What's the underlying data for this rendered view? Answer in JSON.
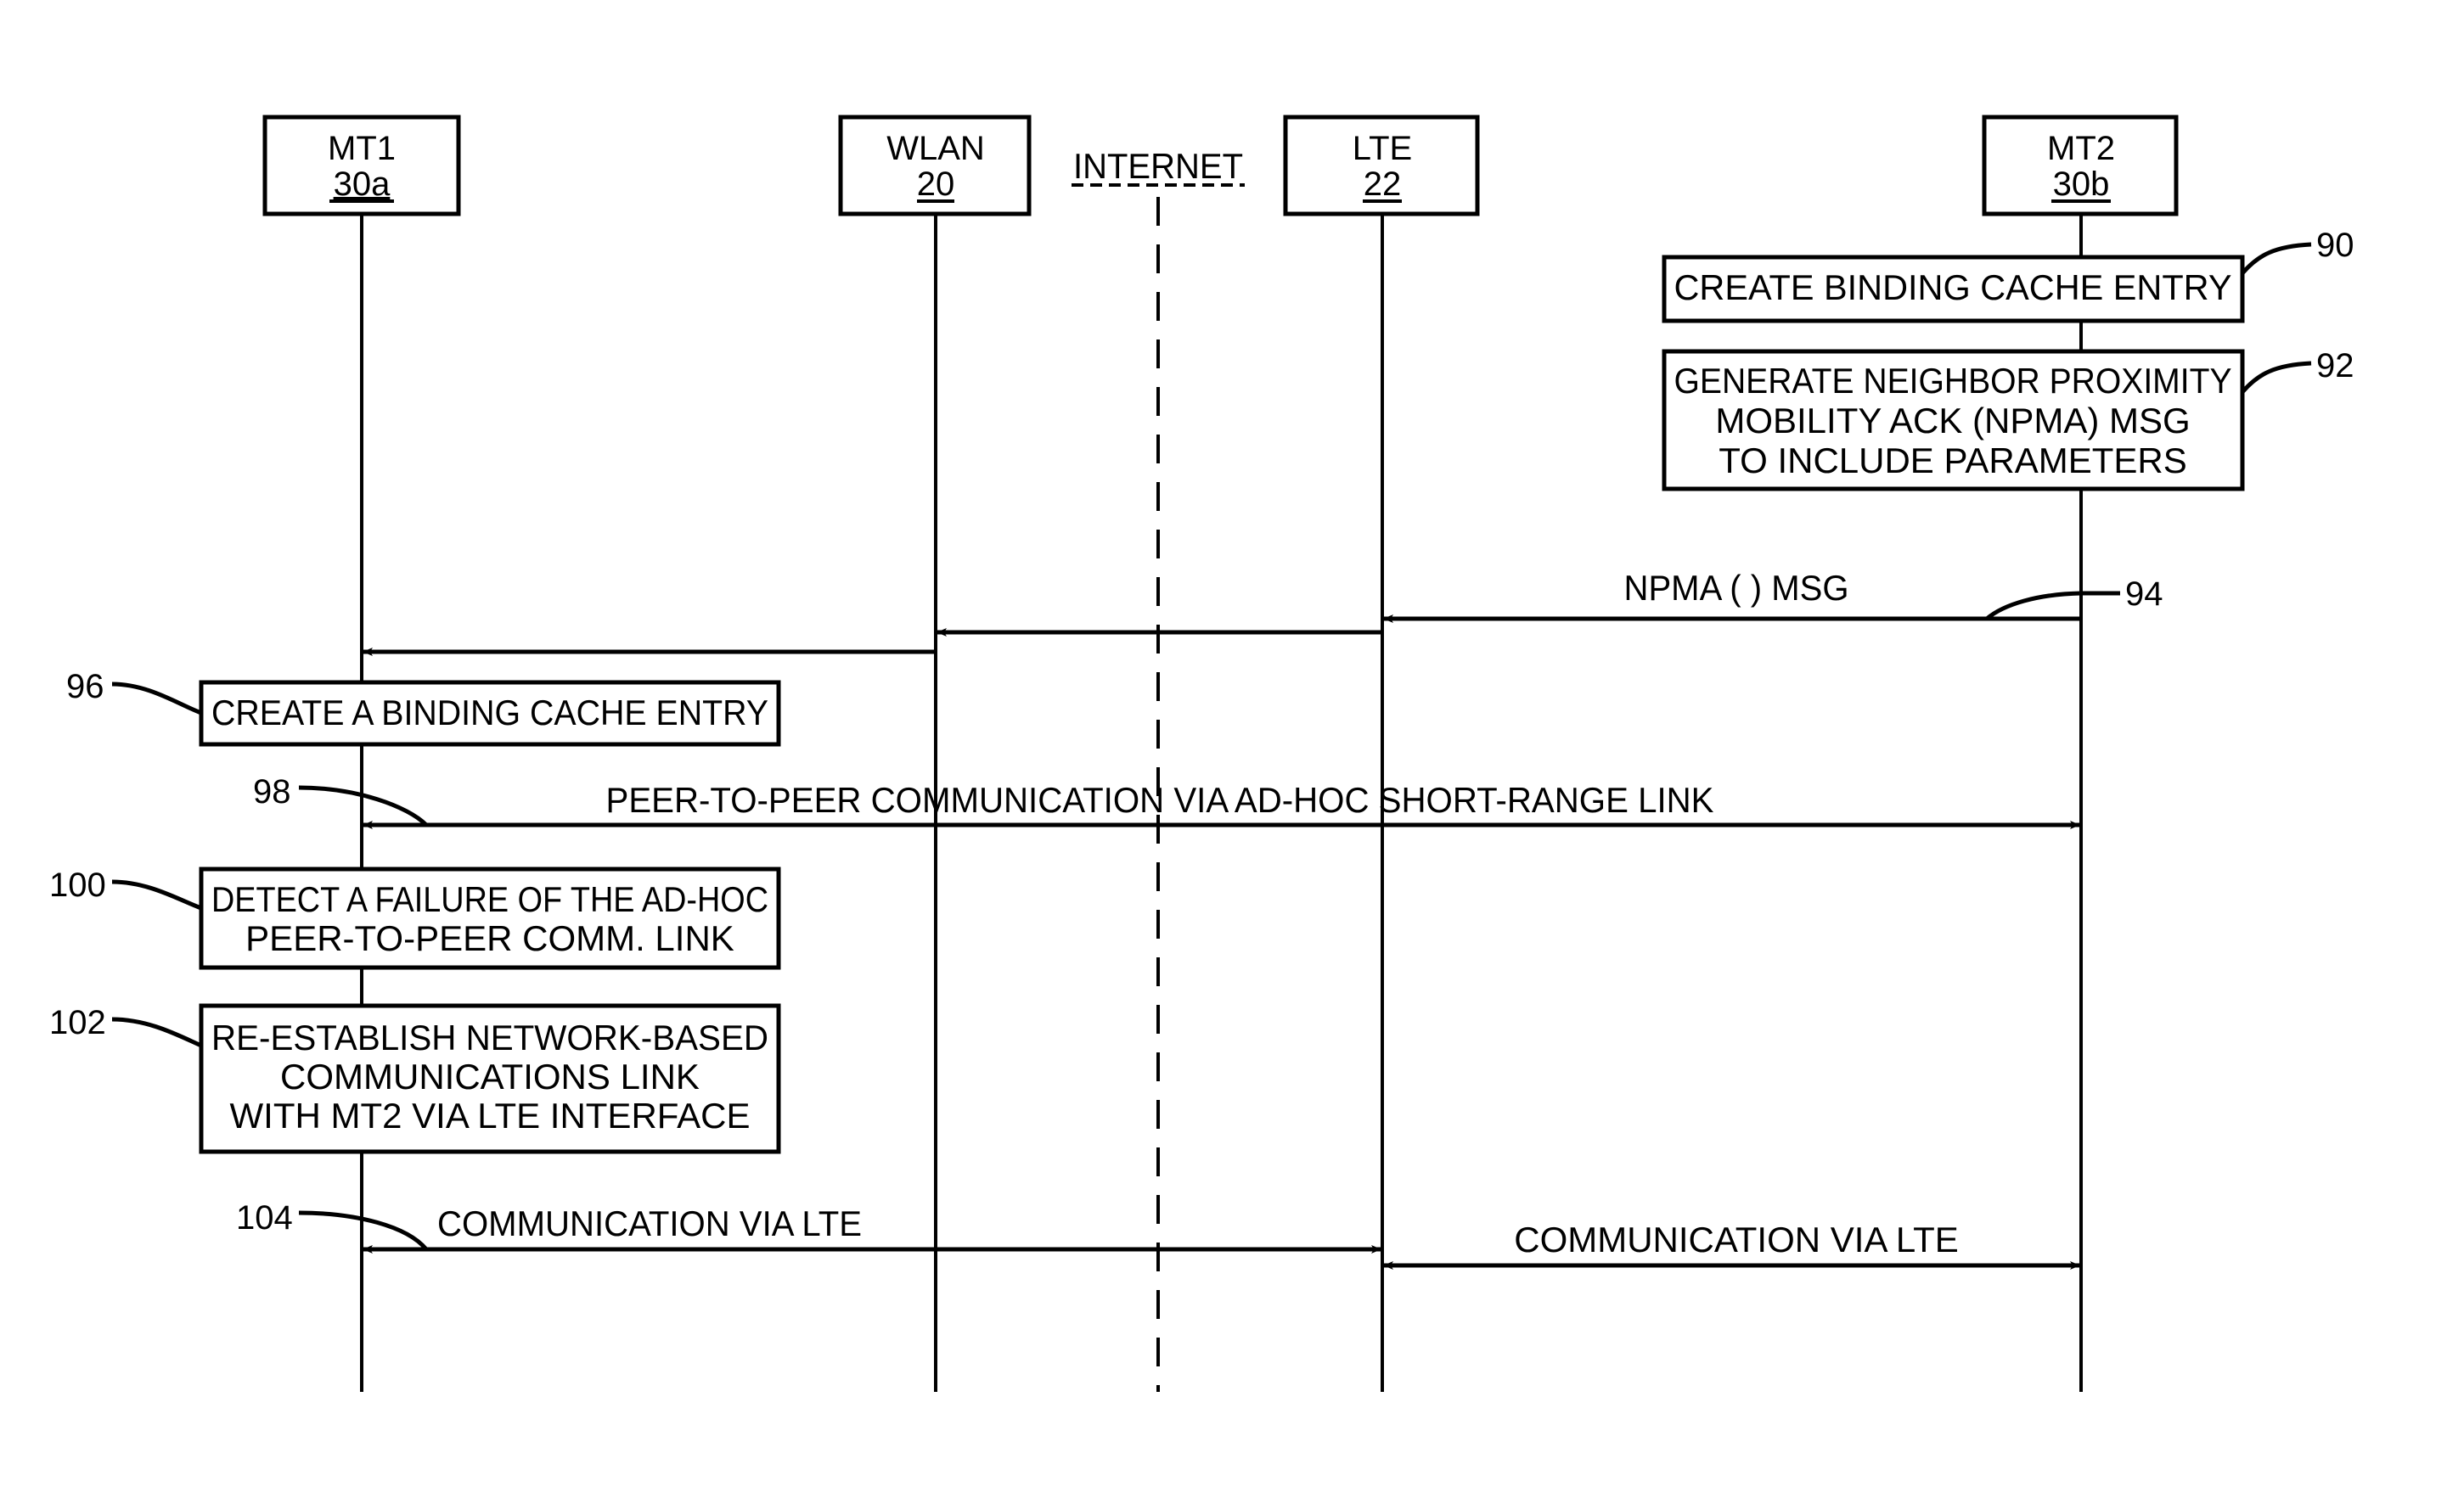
{
  "entities": [
    {
      "id": "mt1",
      "name": "MT1",
      "ref": "30a"
    },
    {
      "id": "wlan",
      "name": "WLAN",
      "ref": "20"
    },
    {
      "id": "lte",
      "name": "LTE",
      "ref": "22"
    },
    {
      "id": "mt2",
      "name": "MT2",
      "ref": "30b"
    }
  ],
  "internet": {
    "label": "INTERNET"
  },
  "steps": {
    "s90": {
      "ref": "90",
      "lines": [
        "CREATE BINDING CACHE ENTRY"
      ]
    },
    "s92": {
      "ref": "92",
      "lines": [
        "GENERATE NEIGHBOR PROXIMITY",
        "MOBILITY ACK (NPMA) MSG",
        "TO INCLUDE PARAMETERS"
      ]
    },
    "s96": {
      "ref": "96",
      "lines": [
        "CREATE A BINDING CACHE ENTRY"
      ]
    },
    "s100": {
      "ref": "100",
      "lines": [
        "DETECT A FAILURE OF THE AD-HOC",
        "PEER-TO-PEER COMM. LINK"
      ]
    },
    "s102": {
      "ref": "102",
      "lines": [
        "RE-ESTABLISH NETWORK-BASED",
        "COMMUNICATIONS LINK",
        "WITH MT2 VIA LTE INTERFACE"
      ]
    }
  },
  "messages": {
    "m94": {
      "ref": "94",
      "label": "NPMA ( ) MSG"
    },
    "m98": {
      "ref": "98",
      "label": "PEER-TO-PEER COMMUNICATION VIA AD-HOC SHORT-RANGE LINK"
    },
    "m104": {
      "ref": "104",
      "label": "COMMUNICATION VIA LTE"
    },
    "m104b": {
      "label": "COMMUNICATION VIA LTE"
    }
  }
}
